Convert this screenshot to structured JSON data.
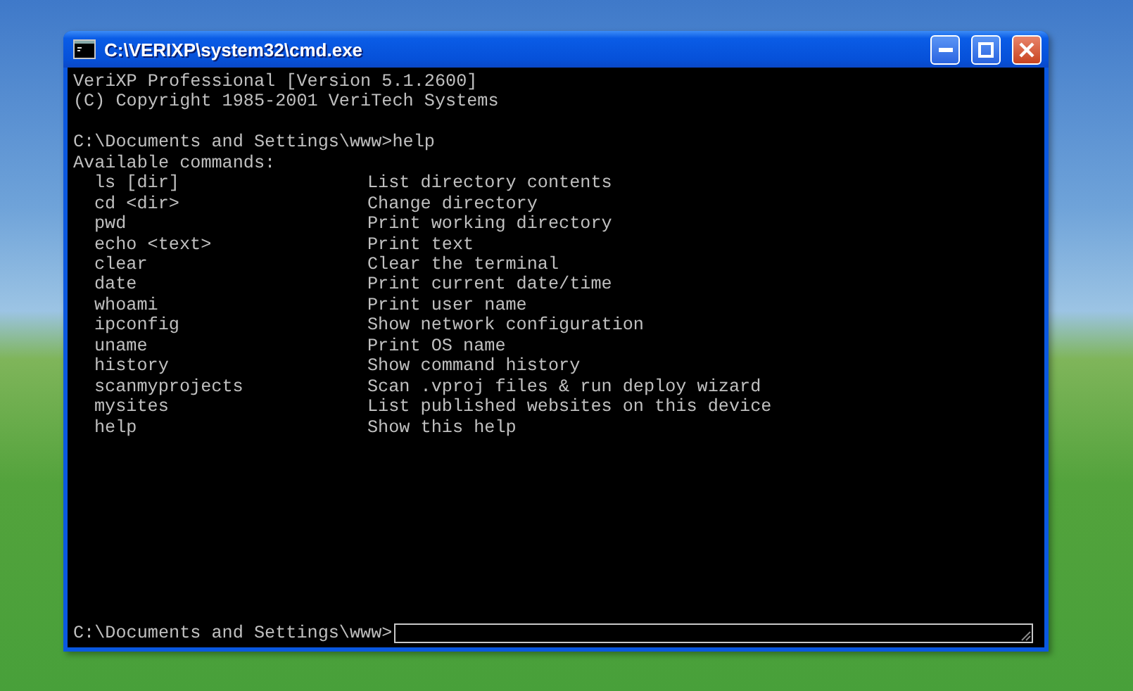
{
  "window": {
    "title": "C:\\VERIXP\\system32\\cmd.exe"
  },
  "terminal": {
    "banner": [
      "VeriXP Professional [Version 5.1.2600]",
      "(C) Copyright 1985-2001 VeriTech Systems"
    ],
    "command_line": "C:\\Documents and Settings\\www>help",
    "heading": "Available commands:",
    "commands": [
      {
        "name": "ls [dir]",
        "description": "List directory contents"
      },
      {
        "name": "cd <dir>",
        "description": "Change directory"
      },
      {
        "name": "pwd",
        "description": "Print working directory"
      },
      {
        "name": "echo <text>",
        "description": "Print text"
      },
      {
        "name": "clear",
        "description": "Clear the terminal"
      },
      {
        "name": "date",
        "description": "Print current date/time"
      },
      {
        "name": "whoami",
        "description": "Print user name"
      },
      {
        "name": "ipconfig",
        "description": "Show network configuration"
      },
      {
        "name": "uname",
        "description": "Print OS name"
      },
      {
        "name": "history",
        "description": "Show command history"
      },
      {
        "name": "scanmyprojects",
        "description": "Scan .vproj files & run deploy wizard"
      },
      {
        "name": "mysites",
        "description": "List published websites on this device"
      },
      {
        "name": "help",
        "description": "Show this help"
      }
    ],
    "prompt": "C:\\Documents and Settings\\www>"
  }
}
